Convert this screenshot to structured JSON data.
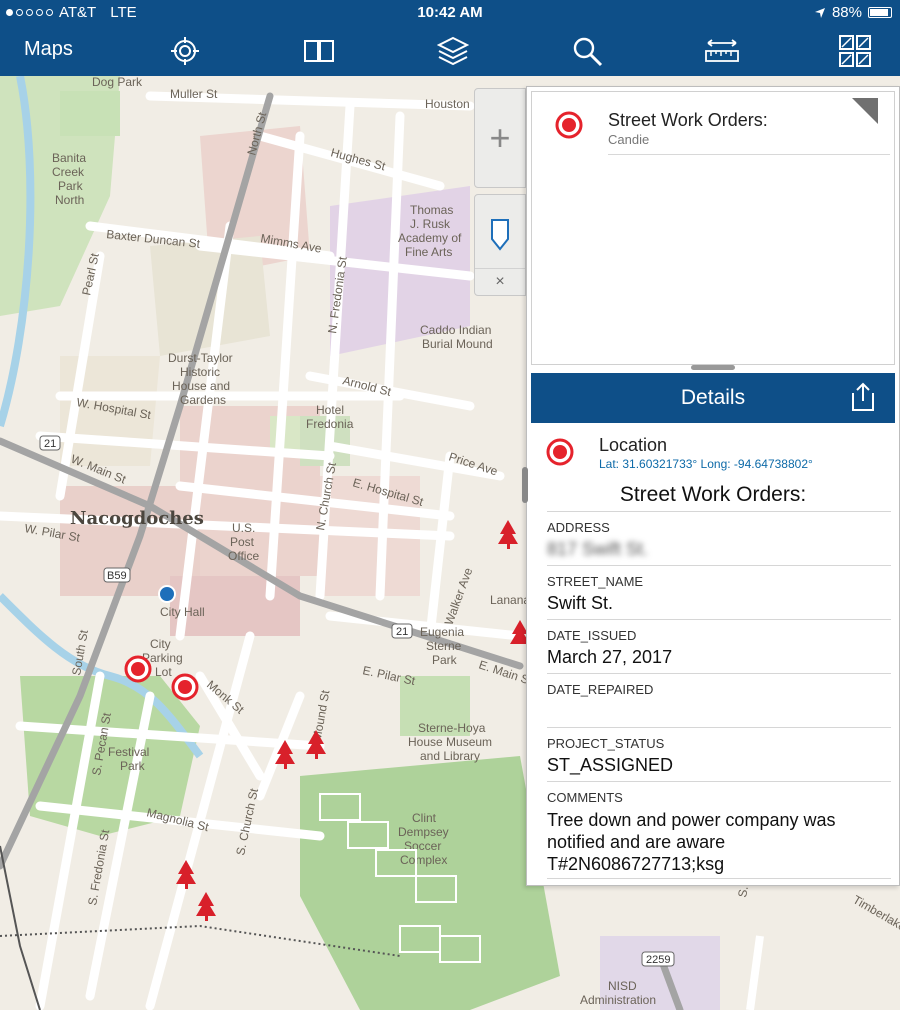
{
  "status": {
    "carrier": "AT&T",
    "network": "LTE",
    "time": "10:42 AM",
    "battery": "88%",
    "battery_level": 0.88,
    "signal_dots_filled": 1
  },
  "toolbar": {
    "title": "Maps",
    "icons": [
      "locate-icon",
      "bookmark-book-icon",
      "layers-icon",
      "search-icon",
      "measure-icon",
      "basemap-gallery-icon"
    ]
  },
  "map_labels": {
    "dog_park": "Dog Park",
    "muller": "Muller St",
    "houston": "Houston",
    "north": "North St",
    "banita": [
      "Banita",
      "Creek",
      "Park",
      "North"
    ],
    "hughes": "Hughes St",
    "baxter": "Baxter Duncan St",
    "mimms": "Mimms Ave",
    "pearl": "Pearl St",
    "rusk": [
      "Thomas",
      "J. Rusk",
      "Academy of",
      "Fine Arts"
    ],
    "nfredonia": "N. Fredonia St",
    "caddo": [
      "Caddo Indian",
      "Burial Mound"
    ],
    "durst": [
      "Durst-Taylor",
      "Historic",
      "House and",
      "Gardens"
    ],
    "arnold": "Arnold St",
    "whospital": "W. Hospital St",
    "hotel": [
      "Hotel",
      "Fredonia"
    ],
    "price": "Price Ave",
    "wmain": "W. Main St",
    "nachurch": "N. Church St",
    "ehospital": "E. Hospital St",
    "nacogdoches": "Nacogdoches",
    "wpilar": "W. Pilar St",
    "usps": [
      "U.S.",
      "Post",
      "Office"
    ],
    "walker": "Walker Ave",
    "lanana": "Lanana",
    "city_hall": "City Hall",
    "city_lot": [
      "City",
      "Parking",
      "Lot"
    ],
    "south": "South St",
    "eugenia": [
      "Eugenia",
      "Sterne",
      "Park"
    ],
    "epilar": "E. Pilar St",
    "emain": "E. Main St",
    "monk": "Monk St",
    "smound": "S. Mound St",
    "specan": "S. Pecan St",
    "festival": [
      "Festival",
      "Park"
    ],
    "sterne": [
      "Sterne-Hoya",
      "House Museum",
      "and Library"
    ],
    "schurch": "S. Church St",
    "magnolia": "Magnolia St",
    "clint": [
      "Clint",
      "Dempsey",
      "Soccer",
      "Complex"
    ],
    "sfredonia": "S. Fredonia St",
    "nisd": [
      "NISD",
      "Administration"
    ],
    "timberlake": "Timberlake",
    "route21a": "21",
    "route21b": "21",
    "b59": "B59",
    "route2259": "2259",
    "shaw": "S. Sh"
  },
  "map_controls": {
    "zoom_in": "+",
    "close": "×"
  },
  "popup": {
    "record_title": "Street Work Orders:",
    "record_subtitle": "Candie",
    "details_title": "Details",
    "location_label": "Location",
    "coords": "Lat: 31.60321733° Long: -94.64738802°",
    "layer_title": "Street Work Orders:",
    "fields": [
      {
        "key": "ADDRESS",
        "value": "817 Swift St."
      },
      {
        "key": "STREET_NAME",
        "value": "Swift St."
      },
      {
        "key": "DATE_ISSUED",
        "value": "March 27, 2017"
      },
      {
        "key": "DATE_REPAIRED",
        "value": ""
      },
      {
        "key": "PROJECT_STATUS",
        "value": "ST_ASSIGNED"
      },
      {
        "key": "COMMENTS",
        "value": "Tree down and power company was notified and are aware T#2N6086727713;ksg"
      }
    ]
  },
  "colors": {
    "toolbar": "#0e4f88",
    "marker_red": "#e5232c",
    "tree_red": "#d8202a",
    "link_blue": "#0d6aa8",
    "park_green": "#b6d7a0"
  }
}
